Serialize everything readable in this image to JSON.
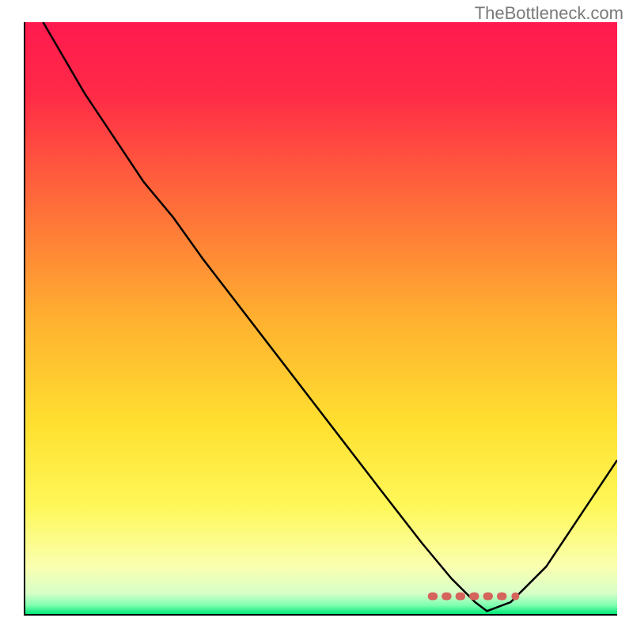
{
  "attribution": "TheBottleneck.com",
  "chart_data": {
    "type": "line",
    "title": "",
    "xlabel": "",
    "ylabel": "",
    "xlim": [
      0,
      100
    ],
    "ylim": [
      0,
      100
    ],
    "gradient_stops": [
      {
        "offset": 0.0,
        "color": "#ff1a4f"
      },
      {
        "offset": 0.12,
        "color": "#ff2a47"
      },
      {
        "offset": 0.3,
        "color": "#ff6a3a"
      },
      {
        "offset": 0.5,
        "color": "#ffb030"
      },
      {
        "offset": 0.68,
        "color": "#ffe030"
      },
      {
        "offset": 0.82,
        "color": "#fff85a"
      },
      {
        "offset": 0.92,
        "color": "#faffb0"
      },
      {
        "offset": 0.965,
        "color": "#d8ffc8"
      },
      {
        "offset": 0.985,
        "color": "#80ffb0"
      },
      {
        "offset": 1.0,
        "color": "#00e878"
      }
    ],
    "series": [
      {
        "name": "bottleneck-curve",
        "color": "#000000",
        "x": [
          3,
          10,
          20,
          25,
          30,
          40,
          50,
          60,
          67,
          72,
          76,
          78,
          82,
          88,
          100
        ],
        "values": [
          100,
          88,
          73,
          67,
          60,
          47,
          34,
          21,
          12,
          6,
          2,
          0.5,
          2,
          8,
          26
        ]
      }
    ],
    "marker_band": {
      "name": "optimal-range",
      "color": "#d4645c",
      "x_start": 68,
      "x_end": 82,
      "y": 3,
      "segments": 6
    }
  }
}
